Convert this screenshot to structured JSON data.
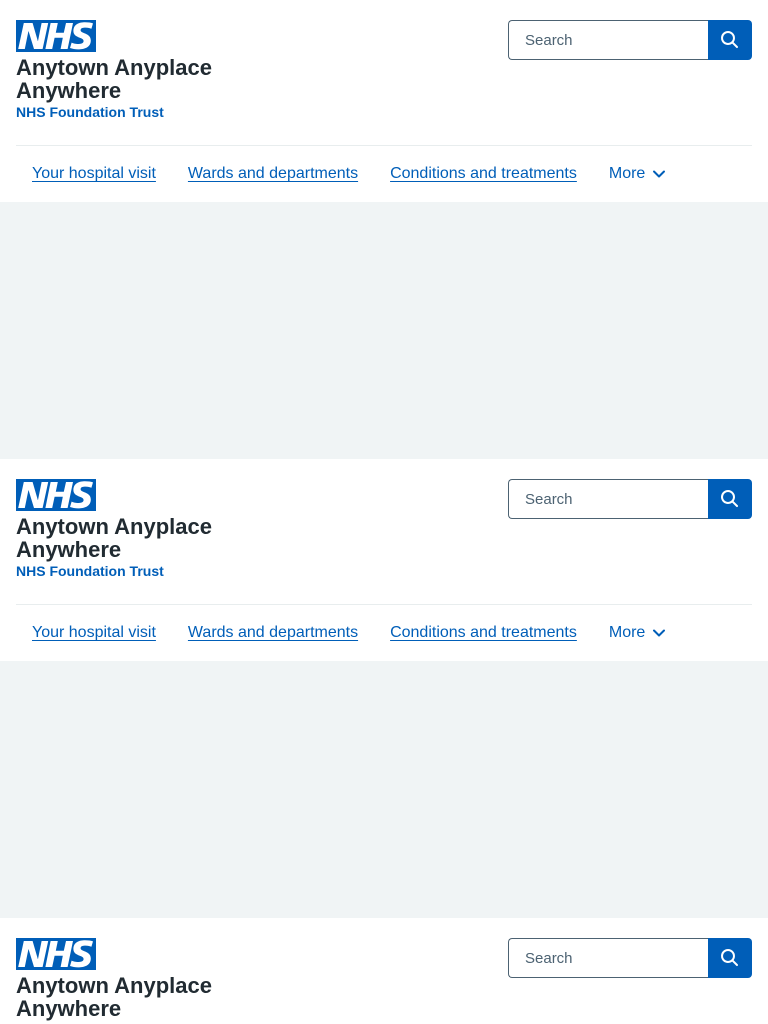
{
  "header": {
    "logo_text": "NHS",
    "org_name": "Anytown Anyplace Anywhere",
    "org_descriptor": "NHS Foundation Trust",
    "search_placeholder": "Search",
    "search_icon": "search-icon",
    "nav": {
      "items": [
        {
          "label": "Your hospital visit"
        },
        {
          "label": "Wards and departments"
        },
        {
          "label": "Conditions and treatments"
        }
      ],
      "more_label": "More",
      "more_icon": "chevron-down-icon"
    }
  },
  "colors": {
    "brand_blue": "#005eb8",
    "text": "#212b32",
    "background_grey": "#f0f4f5",
    "border": "#4c6272"
  }
}
